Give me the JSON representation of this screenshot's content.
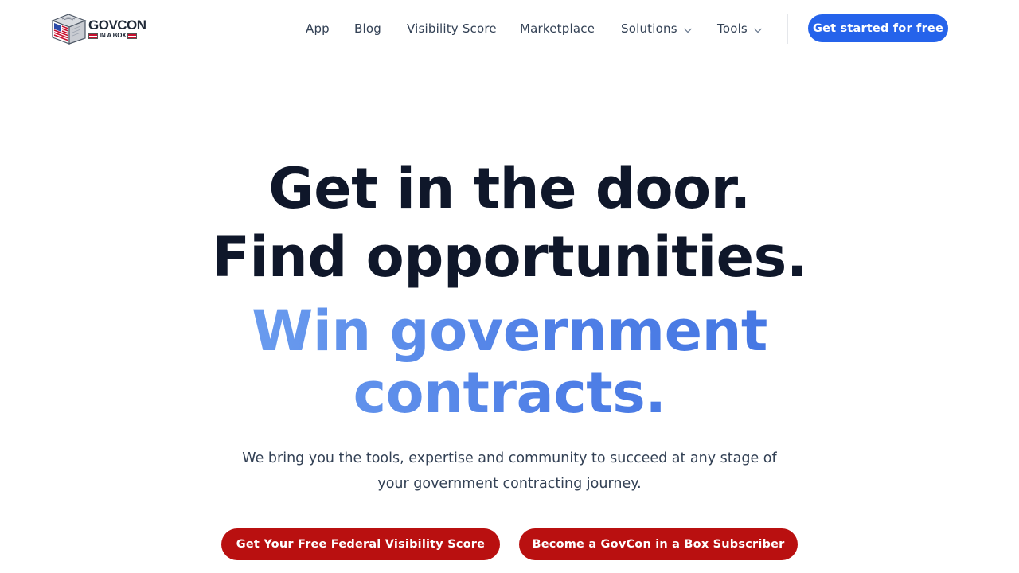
{
  "brand": {
    "name_main": "GOVCON",
    "name_sub": "IN A BOX"
  },
  "nav": {
    "items": [
      {
        "label": "App",
        "has_dropdown": false
      },
      {
        "label": "Blog",
        "has_dropdown": false
      },
      {
        "label": "Visibility Score",
        "has_dropdown": false
      },
      {
        "label": "Marketplace",
        "has_dropdown": false
      },
      {
        "label": "Solutions",
        "has_dropdown": true
      },
      {
        "label": "Tools",
        "has_dropdown": true
      }
    ],
    "cta_label": "Get started for free"
  },
  "hero": {
    "line1": "Get in the door.",
    "line2": "Find opportunities.",
    "line3": "Win government",
    "line4": "contracts.",
    "subtitle_line1": "We bring you the tools, expertise and community to succeed at any stage of",
    "subtitle_line2": "your government contracting journey.",
    "primary_button": "Get Your Free Federal Visibility Score",
    "secondary_button": "Become a GovCon in a Box Subscriber"
  },
  "colors": {
    "primary_blue": "#2563eb",
    "accent_red": "#b91010",
    "heading_dark": "#0f172a",
    "gradient_start": "#7fb2f5",
    "gradient_end": "#3b6fe0"
  },
  "icons": {
    "logo": "govcon-box-logo-icon",
    "dropdown": "chevron-down-icon"
  }
}
